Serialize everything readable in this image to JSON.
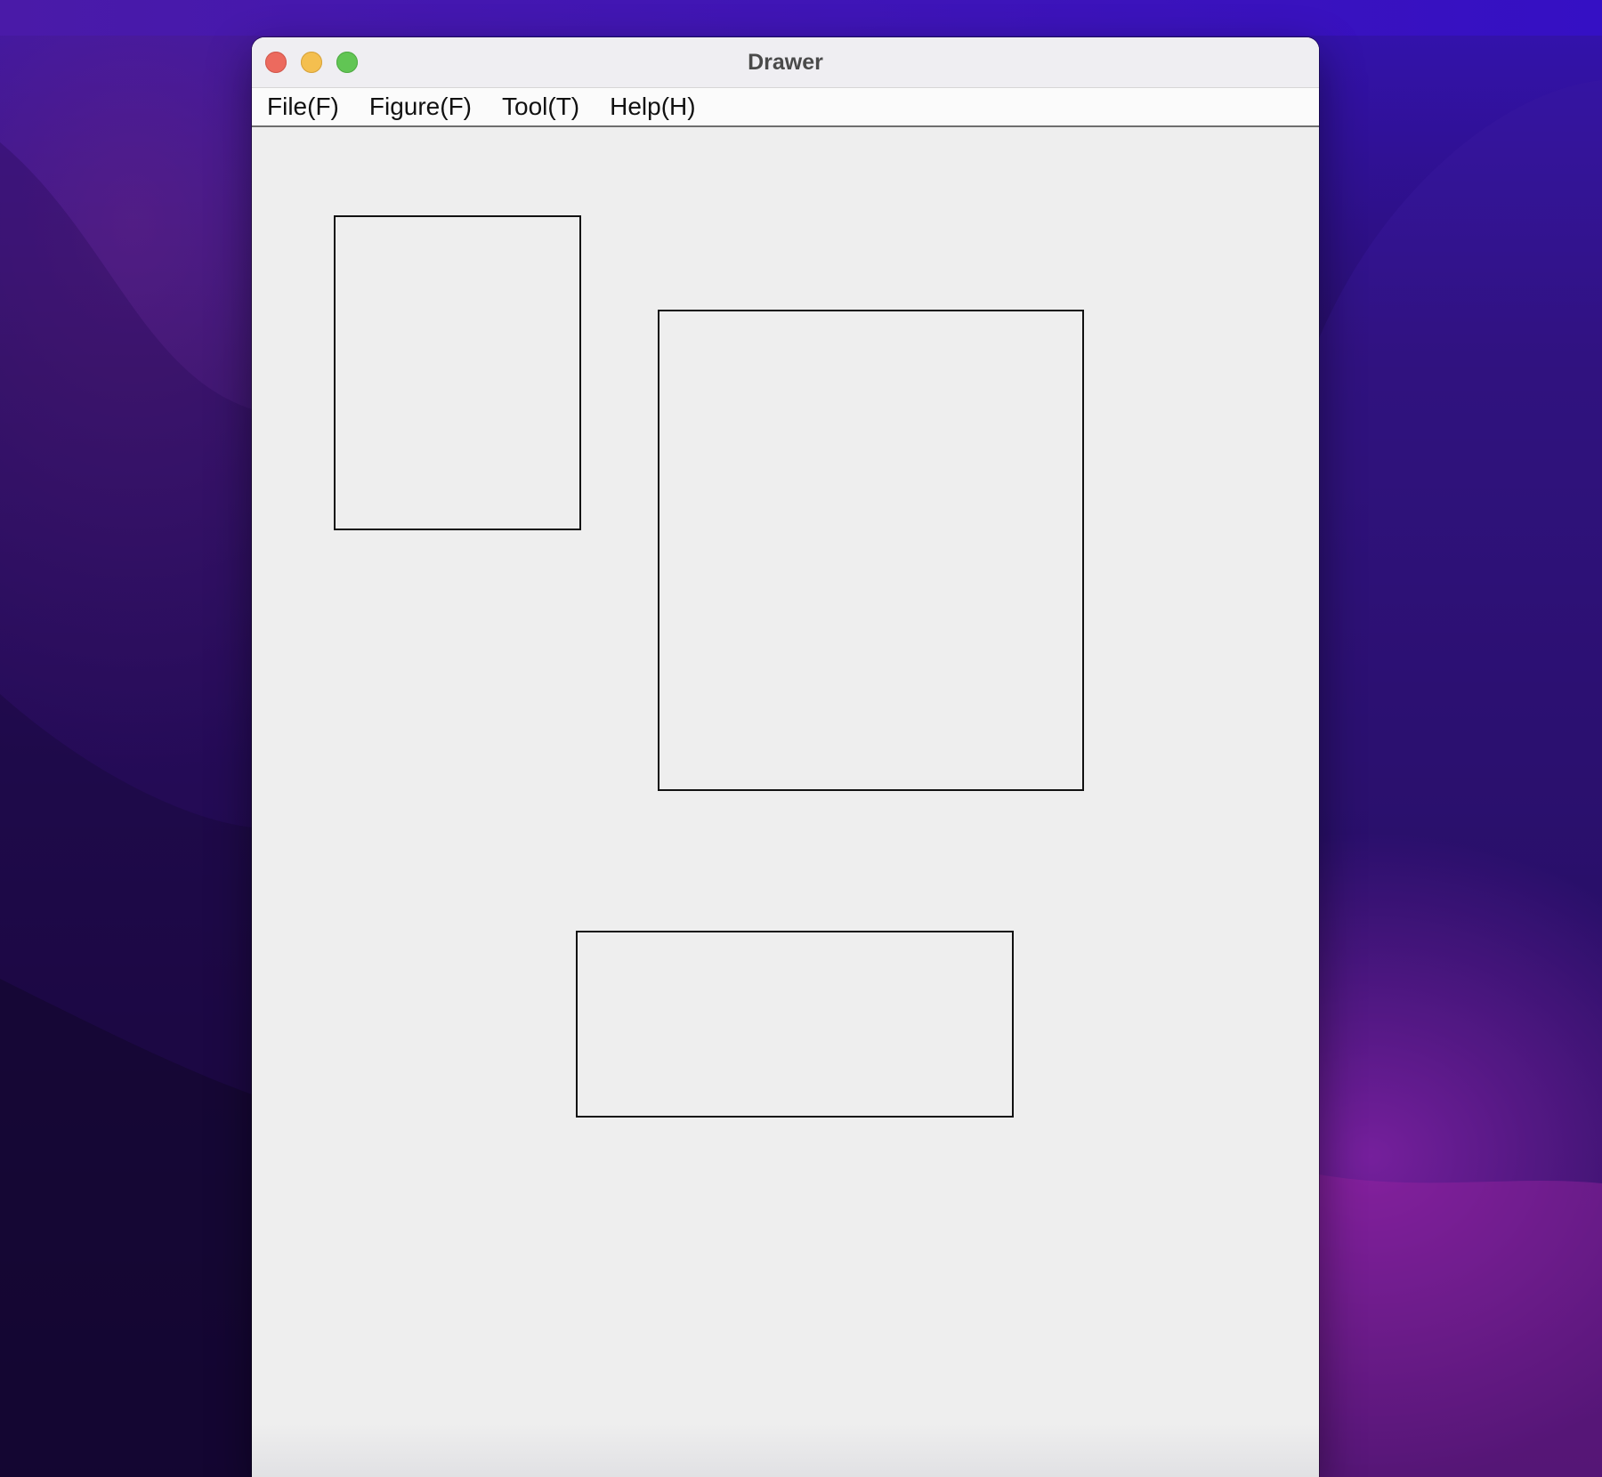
{
  "window": {
    "title": "Drawer"
  },
  "menubar": {
    "items": [
      {
        "label": "File(F)"
      },
      {
        "label": "Figure(F)"
      },
      {
        "label": "Tool(T)"
      },
      {
        "label": "Help(H)"
      }
    ]
  },
  "canvas": {
    "shapes": [
      {
        "type": "rectangle",
        "stroke": "#111111"
      },
      {
        "type": "rectangle",
        "stroke": "#111111"
      },
      {
        "type": "rectangle",
        "stroke": "#111111"
      }
    ]
  },
  "colors": {
    "close": "#ec6a5e",
    "minimize": "#f4bf4f",
    "zoom": "#61c554",
    "canvas_background": "#eeeeee"
  }
}
